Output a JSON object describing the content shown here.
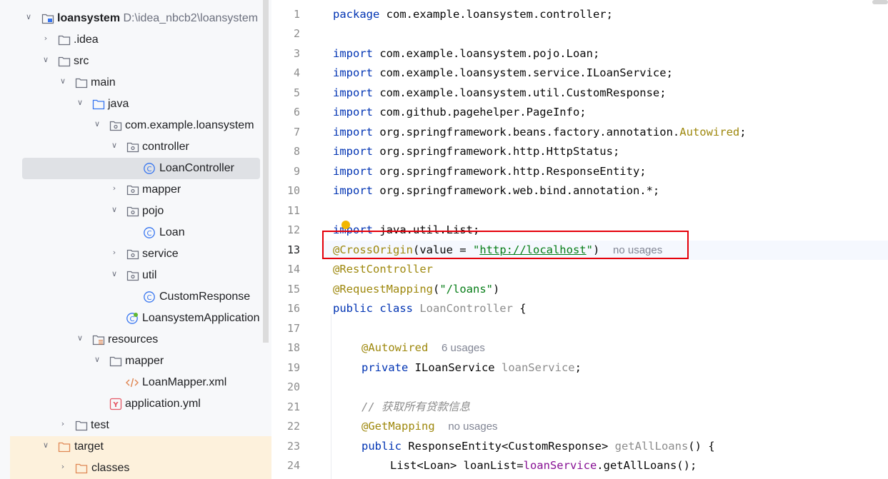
{
  "project_tree": {
    "root": {
      "name": "loansystem",
      "path": "D:\\idea_nbcb2\\loansystem"
    },
    "items": [
      {
        "label": ".idea"
      },
      {
        "label": "src"
      },
      {
        "label": "main"
      },
      {
        "label": "java"
      },
      {
        "label": "com.example.loansystem"
      },
      {
        "label": "controller"
      },
      {
        "label": "LoanController"
      },
      {
        "label": "mapper"
      },
      {
        "label": "pojo"
      },
      {
        "label": "Loan"
      },
      {
        "label": "service"
      },
      {
        "label": "util"
      },
      {
        "label": "CustomResponse"
      },
      {
        "label": "LoansystemApplication"
      },
      {
        "label": "resources"
      },
      {
        "label": "mapper"
      },
      {
        "label": "LoanMapper.xml"
      },
      {
        "label": "application.yml"
      },
      {
        "label": "test"
      },
      {
        "label": "target"
      },
      {
        "label": "classes"
      }
    ]
  },
  "editor": {
    "line_numbers": [
      "1",
      "2",
      "3",
      "4",
      "5",
      "6",
      "7",
      "8",
      "9",
      "10",
      "11",
      "12",
      "13",
      "14",
      "15",
      "16",
      "17",
      "18",
      "19",
      "20",
      "21",
      "22",
      "23",
      "24"
    ],
    "current_line": "13",
    "code": {
      "l1": {
        "kw": "package",
        "rest": " com.example.loansystem.controller;"
      },
      "l3": {
        "kw": "import",
        "rest": " com.example.loansystem.pojo.Loan;"
      },
      "l4": {
        "kw": "import",
        "rest": " com.example.loansystem.service.ILoanService;"
      },
      "l5": {
        "kw": "import",
        "rest": " com.example.loansystem.util.CustomResponse;"
      },
      "l6": {
        "kw": "import",
        "rest": " com.github.pagehelper.PageInfo;"
      },
      "l7": {
        "kw": "import",
        "rest": " org.springframework.beans.factory.annotation.",
        "ann": "Autowired",
        "end": ";"
      },
      "l8": {
        "kw": "import",
        "rest": " org.springframework.http.HttpStatus;"
      },
      "l9": {
        "kw": "import",
        "rest": " org.springframework.http.ResponseEntity;"
      },
      "l10": {
        "kw": "import",
        "rest": " org.springframework.web.bind.annotation.*;"
      },
      "l12": {
        "kw": "import",
        "rest": " java.util.List;"
      },
      "l13": {
        "ann": "@CrossOrigin",
        "open": "(value = ",
        "q1": "\"",
        "url": "http://localhost",
        "q2": "\"",
        "close": ")",
        "hint": "no usages"
      },
      "l14": {
        "ann": "@RestController"
      },
      "l15": {
        "ann": "@RequestMapping",
        "open": "(",
        "str": "\"/loans\"",
        "close": ")"
      },
      "l16": {
        "kw": "public class",
        "cls": " LoanController",
        "rest": " {"
      },
      "l18": {
        "ann": "@Autowired",
        "hint": "6 usages"
      },
      "l19": {
        "kw": "private",
        "type": " ILoanService ",
        "field": "loanService",
        "end": ";"
      },
      "l21": {
        "comment": "// 获取所有贷款信息"
      },
      "l22": {
        "ann": "@GetMapping",
        "hint": "no usages"
      },
      "l23": {
        "kw": "public",
        "type": " ResponseEntity<CustomResponse> ",
        "method": "getAllLoans",
        "end": "() {"
      },
      "l24": {
        "type": "List<Loan> loanList=",
        "field": "loanService",
        "end": ".getAllLoans();"
      }
    }
  }
}
